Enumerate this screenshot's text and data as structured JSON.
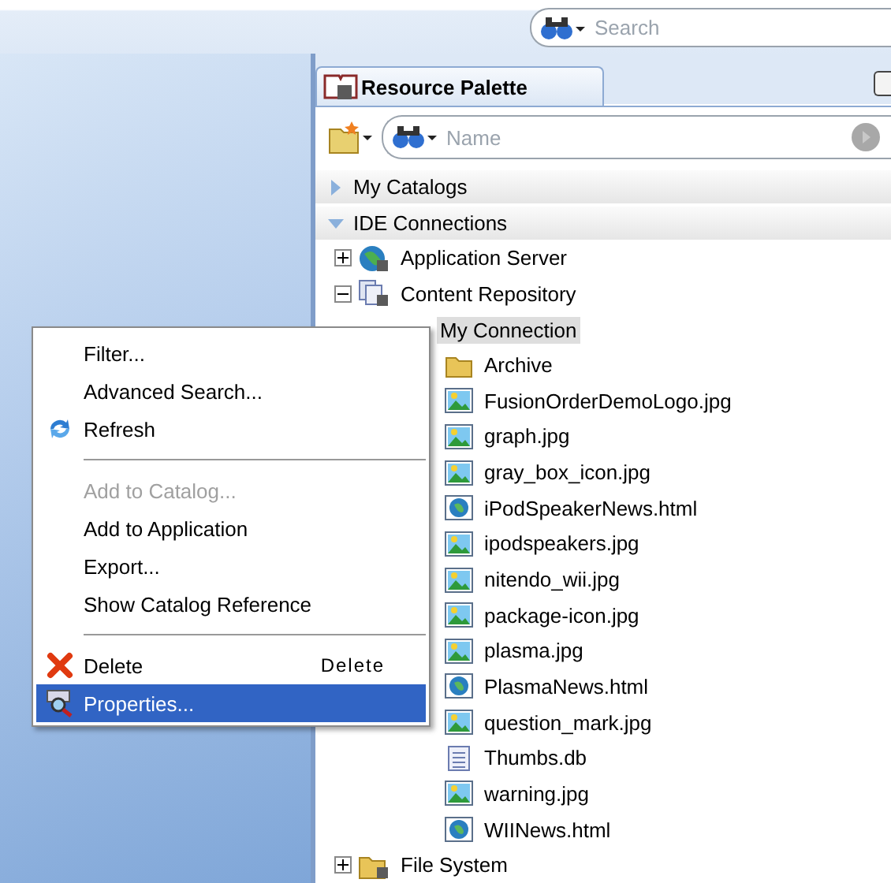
{
  "search": {
    "placeholder": "Search"
  },
  "palette": {
    "title": "Resource Palette",
    "name_search": {
      "placeholder": "Name"
    },
    "sections": [
      {
        "label": "My Catalogs",
        "expanded": false
      },
      {
        "label": "IDE Connections",
        "expanded": true
      }
    ],
    "tree": [
      {
        "label": "Application Server",
        "kind": "server",
        "expanded": false
      },
      {
        "label": "Content Repository",
        "kind": "repository",
        "expanded": true,
        "children": [
          {
            "label": "My Connection",
            "selected": true,
            "children": [
              {
                "label": "Archive",
                "kind": "folder"
              },
              {
                "label": "FusionOrderDemoLogo.jpg",
                "kind": "image"
              },
              {
                "label": "graph.jpg",
                "kind": "image"
              },
              {
                "label": "gray_box_icon.jpg",
                "kind": "image"
              },
              {
                "label": "iPodSpeakerNews.html",
                "kind": "web"
              },
              {
                "label": "ipodspeakers.jpg",
                "kind": "image"
              },
              {
                "label": "nitendo_wii.jpg",
                "kind": "image"
              },
              {
                "label": "package-icon.jpg",
                "kind": "image"
              },
              {
                "label": "plasma.jpg",
                "kind": "image"
              },
              {
                "label": "PlasmaNews.html",
                "kind": "web"
              },
              {
                "label": "question_mark.jpg",
                "kind": "image"
              },
              {
                "label": "Thumbs.db",
                "kind": "doc"
              },
              {
                "label": "warning.jpg",
                "kind": "image"
              },
              {
                "label": "WIINews.html",
                "kind": "web"
              }
            ]
          }
        ]
      },
      {
        "label": "File System",
        "kind": "drive",
        "expanded": false
      }
    ]
  },
  "context_menu": {
    "items": [
      {
        "kind": "plain",
        "label": "Filter...",
        "disabled": false,
        "selected": false
      },
      {
        "kind": "plain",
        "label": "Advanced Search...",
        "disabled": false,
        "selected": false
      },
      {
        "kind": "refresh",
        "label": "Refresh",
        "disabled": false,
        "selected": false
      },
      {
        "kind": "separator"
      },
      {
        "kind": "plain",
        "label": "Add to Catalog...",
        "disabled": true,
        "selected": false
      },
      {
        "kind": "plain",
        "label": "Add to Application",
        "disabled": false,
        "selected": false
      },
      {
        "kind": "plain",
        "label": "Export...",
        "disabled": false,
        "selected": false
      },
      {
        "kind": "plain",
        "label": "Show Catalog Reference",
        "disabled": false,
        "selected": false
      },
      {
        "kind": "separator"
      },
      {
        "kind": "delete",
        "label": "Delete",
        "shortcut": "Delete",
        "disabled": false,
        "selected": false
      },
      {
        "kind": "properties",
        "label": "Properties...",
        "disabled": false,
        "selected": true
      }
    ]
  }
}
